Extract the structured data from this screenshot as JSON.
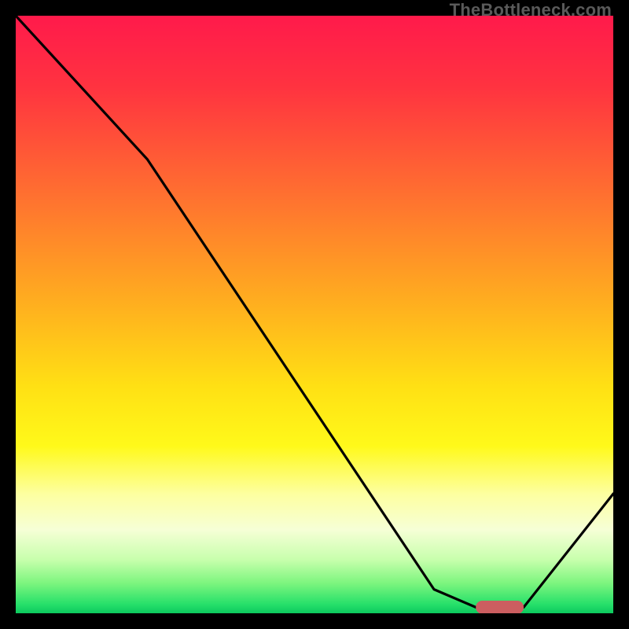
{
  "watermark": "TheBottleneck.com",
  "chart_data": {
    "type": "line",
    "title": "",
    "xlabel": "",
    "ylabel": "",
    "xlim": [
      0,
      100
    ],
    "ylim": [
      0,
      100
    ],
    "grid": false,
    "legend": false,
    "gradient_stops": [
      {
        "offset": 0.0,
        "color": "#ff1a4b"
      },
      {
        "offset": 0.12,
        "color": "#ff3340"
      },
      {
        "offset": 0.3,
        "color": "#ff7030"
      },
      {
        "offset": 0.48,
        "color": "#ffae1f"
      },
      {
        "offset": 0.62,
        "color": "#ffe014"
      },
      {
        "offset": 0.72,
        "color": "#fff91a"
      },
      {
        "offset": 0.8,
        "color": "#fdffa0"
      },
      {
        "offset": 0.86,
        "color": "#f6ffd6"
      },
      {
        "offset": 0.91,
        "color": "#c8ffad"
      },
      {
        "offset": 0.95,
        "color": "#7cf57e"
      },
      {
        "offset": 0.985,
        "color": "#26e06a"
      },
      {
        "offset": 1.0,
        "color": "#0cc95e"
      }
    ],
    "series": [
      {
        "name": "bottleneck-curve",
        "color": "#000000",
        "x": [
          0,
          22,
          70,
          77,
          85,
          100
        ],
        "y": [
          100,
          76,
          4,
          1,
          1,
          20
        ]
      }
    ],
    "marker": {
      "name": "optimal-range",
      "color": "#cc5e60",
      "x_start": 77,
      "x_end": 85,
      "y": 1,
      "thickness": 2.2
    }
  }
}
